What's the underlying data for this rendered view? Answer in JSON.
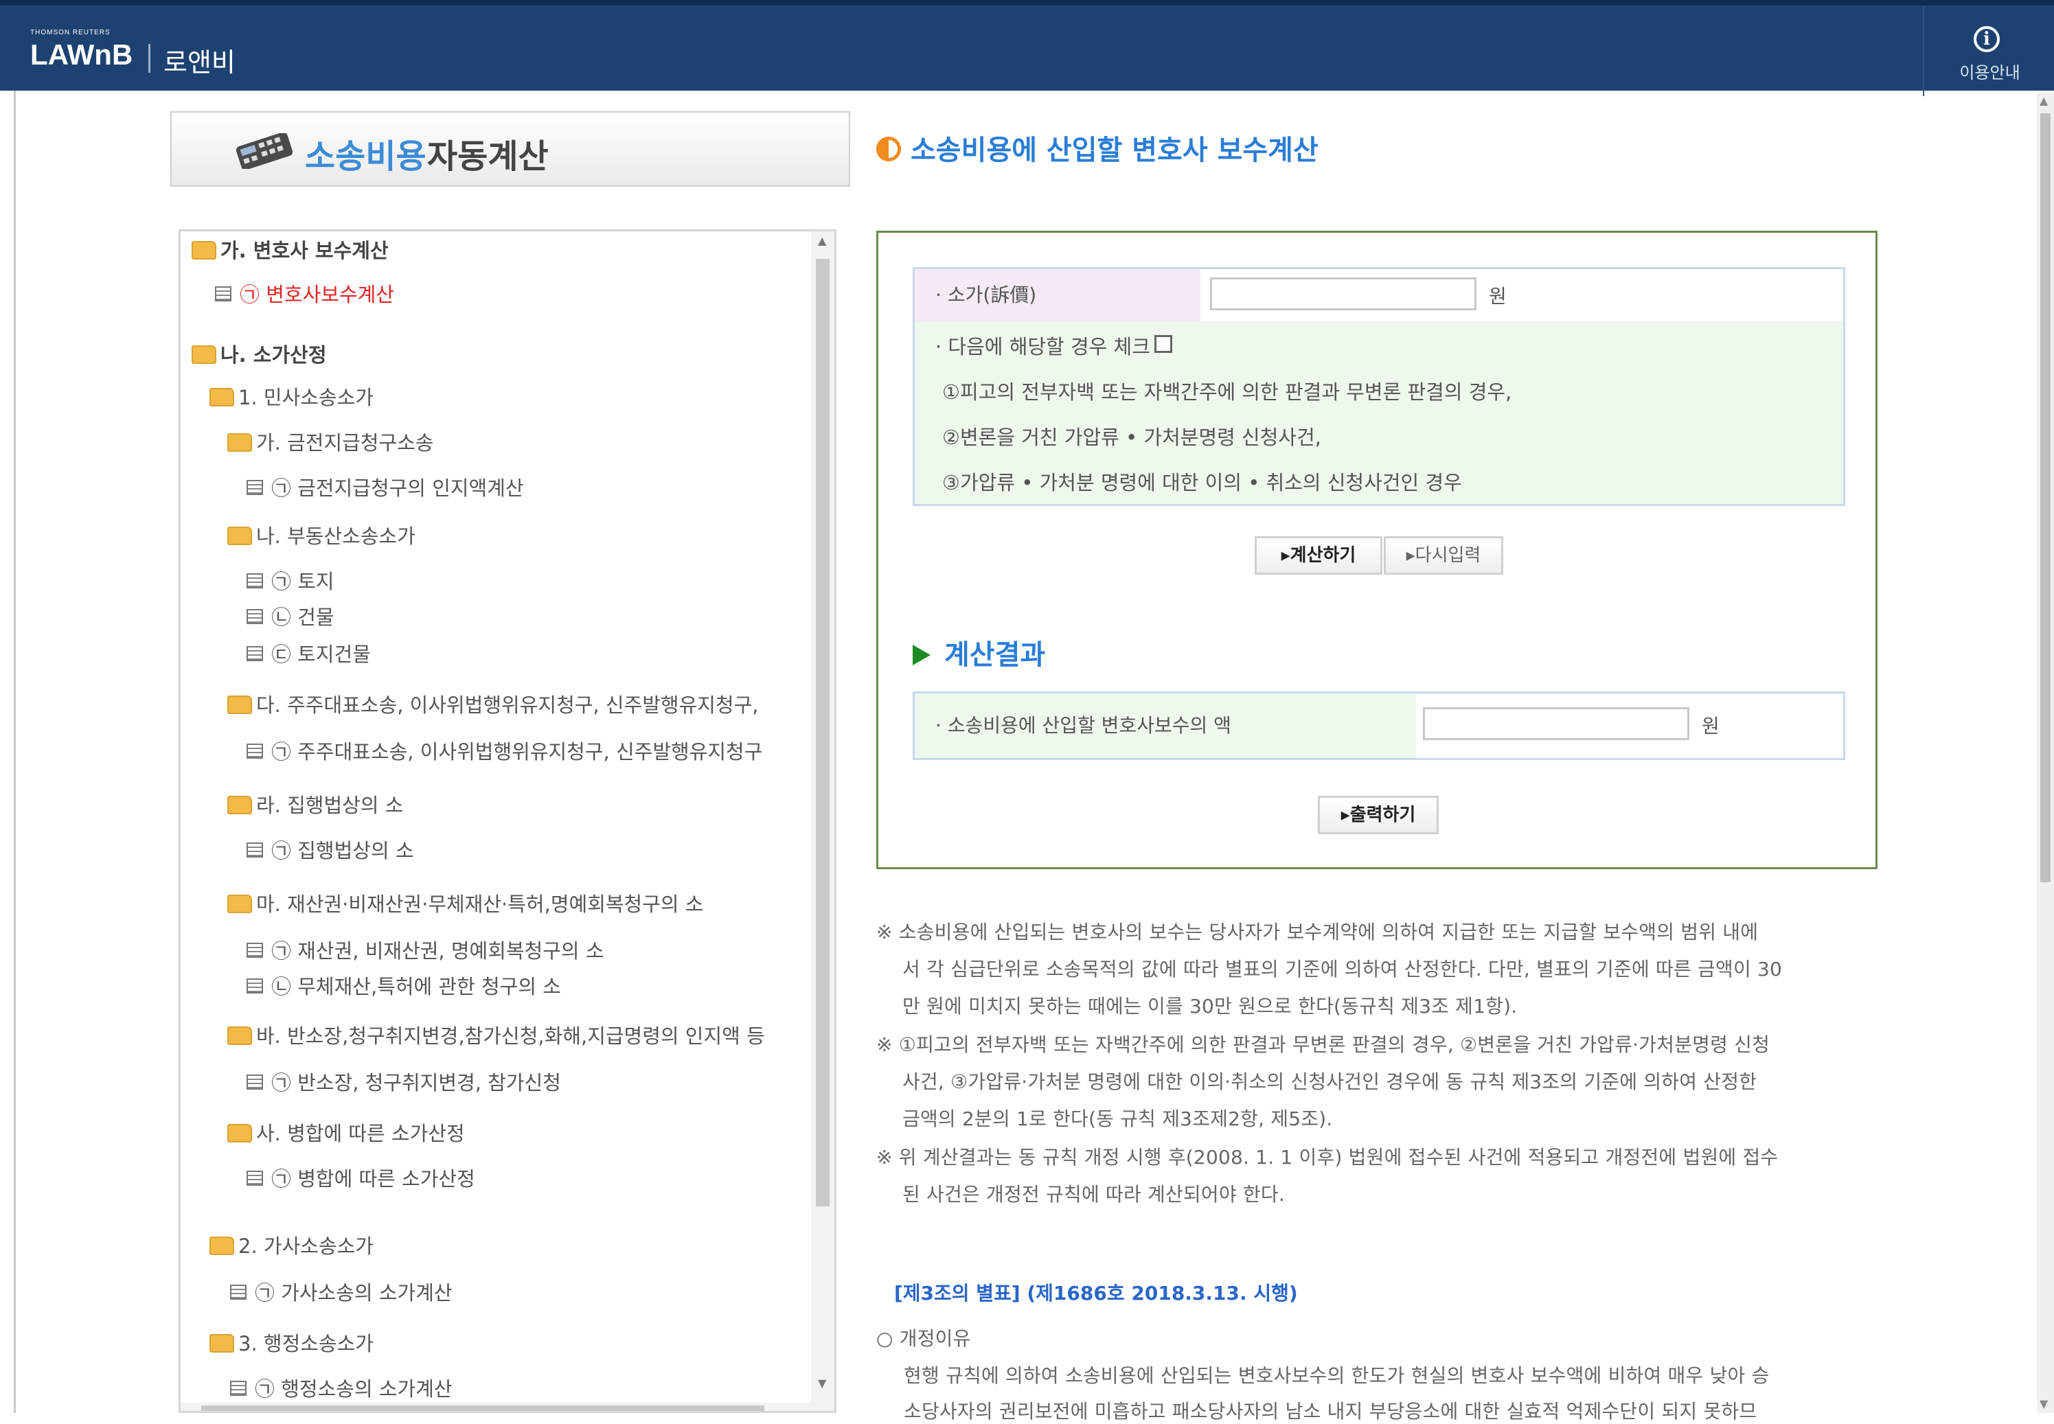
{
  "header": {
    "brand_small": "THOMSON REUTERS",
    "brand": "LAWnB",
    "brand_ko": "로앤비",
    "help_label": "이용안내",
    "help_icon": "info-icon",
    "bg_color": "#1d4271"
  },
  "title": {
    "highlight": "소송비용",
    "rest": "자동계산",
    "icon": "calculator-icon"
  },
  "tree": {
    "nodes": [
      {
        "label": "가. 변호사 보수계산",
        "type": "folder"
      },
      {
        "label": "㉠ 변호사보수계산",
        "type": "doc"
      },
      {
        "label": "나. 소가산정",
        "type": "folder"
      },
      {
        "label": "1. 민사소송소가",
        "type": "folder"
      },
      {
        "label": "가. 금전지급청구소송",
        "type": "folder"
      },
      {
        "label": "㉠ 금전지급청구의 인지액계산",
        "type": "doc"
      },
      {
        "label": "나. 부동산소송소가",
        "type": "folder"
      },
      {
        "label": "㉠ 토지",
        "type": "doc"
      },
      {
        "label": "㉡ 건물",
        "type": "doc"
      },
      {
        "label": "㉢ 토지건물",
        "type": "doc"
      },
      {
        "label": "다. 주주대표소송, 이사위법행위유지청구, 신주발행유지청구,",
        "type": "folder"
      },
      {
        "label": "㉠ 주주대표소송, 이사위법행위유지청구, 신주발행유지청구",
        "type": "doc"
      },
      {
        "label": "라. 집행법상의 소",
        "type": "folder"
      },
      {
        "label": "㉠ 집행법상의 소",
        "type": "doc"
      },
      {
        "label": "마. 재산권·비재산권·무체재산·특허,명예회복청구의 소",
        "type": "folder"
      },
      {
        "label": "㉠ 재산권, 비재산권, 명예회복청구의 소",
        "type": "doc"
      },
      {
        "label": "㉡ 무체재산,특허에 관한 청구의 소",
        "type": "doc"
      },
      {
        "label": "바. 반소장,청구취지변경,참가신청,화해,지급명령의 인지액 등",
        "type": "folder"
      },
      {
        "label": "㉠ 반소장, 청구취지변경, 참가신청",
        "type": "doc"
      },
      {
        "label": "사. 병합에 따른 소가산정",
        "type": "folder"
      },
      {
        "label": "㉠ 병합에 따른 소가산정",
        "type": "doc"
      },
      {
        "label": "2. 가사소송소가",
        "type": "folder"
      },
      {
        "label": "㉠ 가사소송의 소가계산",
        "type": "doc"
      },
      {
        "label": "3. 행정소송소가",
        "type": "folder"
      },
      {
        "label": "㉠ 행정소송의 소가계산",
        "type": "doc"
      }
    ]
  },
  "main": {
    "heading": "소송비용에 산입할 변호사 보수계산",
    "form": {
      "sogа_label": "· 소가(訴價)",
      "soga_value": "",
      "unit": "원",
      "check_label": "· 다음에 해당할 경우 체크",
      "cond1": "①피고의 전부자백 또는 자백간주에 의한 판결과 무변론 판결의 경우,",
      "cond2": "②변론을 거친 가압류 • 가처분명령 신청사건,",
      "cond3": "③가압류 • 가처분 명령에 대한 이의 • 취소의 신청사건인 경우",
      "calc_button": "▸계산하기",
      "reset_button": "▸다시입력"
    },
    "result": {
      "heading": "계산결과",
      "label": "· 소송비용에 산입할 변호사보수의 액",
      "value": "",
      "unit": "원",
      "print_button": "▸출력하기"
    }
  },
  "notes": {
    "n1_l1": "※ 소송비용에 산입되는 변호사의 보수는 당사자가 보수계약에 의하여 지급한 또는 지급할 보수액의 범위 내에",
    "n1_l2": "서 각 심급단위로 소송목적의 값에 따라 별표의 기준에 의하여 산정한다. 다만, 별표의 기준에 따른 금액이 30",
    "n1_l3": "만 원에 미치지 못하는 때에는 이를 30만 원으로 한다(동규칙 제3조 제1항).",
    "n2_l1": "※ ①피고의 전부자백 또는 자백간주에 의한 판결과 무변론 판결의 경우, ②변론을 거친 가압류·가처분명령 신청",
    "n2_l2": "사건, ③가압류·가처분 명령에 대한 이의·취소의 신청사건인 경우에 동 규칙 제3조의 기준에 의하여 산정한",
    "n2_l3": "금액의 2분의 1로 한다(동 규칙 제3조제2항, 제5조).",
    "n3_l1": "※ 위 계산결과는 동 규칙 개정 시행 후(2008. 1. 1 이후) 법원에 접수된 사건에 적용되고 개정전에 법원에 접수",
    "n3_l2": "된 사건은 개정전 규칙에 따라 계산되어야 한다.",
    "link": "[제3조의 별표] (제1686호 2018.3.13. 시행)",
    "reason_title": "○ 개정이유",
    "reason_l1": "현행 규칙에 의하여 소송비용에 산입되는 변호사보수의 한도가 현실의 변호사 보수액에 비하여 매우 낮아 승",
    "reason_l2": "소당사자의 권리보전에 미흡하고 패소당사자의 남소 내지 부당응소에 대한 실효적 억제수단이 되지 못하므"
  }
}
